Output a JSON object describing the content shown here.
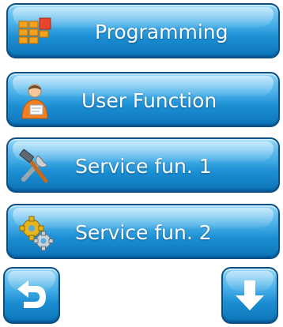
{
  "menu": {
    "items": [
      {
        "label": "Programming",
        "icon": "program-grid-icon"
      },
      {
        "label": "User Function",
        "icon": "user-icon"
      },
      {
        "label": "Service fun. 1",
        "icon": "tools-icon"
      },
      {
        "label": "Service fun. 2",
        "icon": "gears-icon"
      }
    ]
  },
  "nav": {
    "back_icon": "back-arrow-icon",
    "down_icon": "down-arrow-icon"
  },
  "colors": {
    "button_top": "#8ad3f7",
    "button_bottom": "#0d74b8",
    "button_border": "#0c4f82",
    "label": "#ffffff"
  }
}
